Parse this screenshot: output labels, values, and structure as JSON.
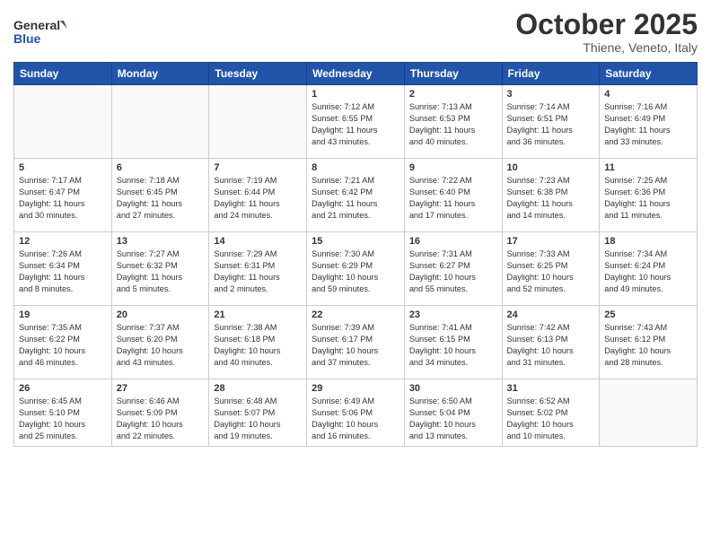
{
  "header": {
    "logo_general": "General",
    "logo_blue": "Blue",
    "month_title": "October 2025",
    "location": "Thiene, Veneto, Italy"
  },
  "days_of_week": [
    "Sunday",
    "Monday",
    "Tuesday",
    "Wednesday",
    "Thursday",
    "Friday",
    "Saturday"
  ],
  "weeks": [
    [
      {
        "day": "",
        "info": ""
      },
      {
        "day": "",
        "info": ""
      },
      {
        "day": "",
        "info": ""
      },
      {
        "day": "1",
        "info": "Sunrise: 7:12 AM\nSunset: 6:55 PM\nDaylight: 11 hours\nand 43 minutes."
      },
      {
        "day": "2",
        "info": "Sunrise: 7:13 AM\nSunset: 6:53 PM\nDaylight: 11 hours\nand 40 minutes."
      },
      {
        "day": "3",
        "info": "Sunrise: 7:14 AM\nSunset: 6:51 PM\nDaylight: 11 hours\nand 36 minutes."
      },
      {
        "day": "4",
        "info": "Sunrise: 7:16 AM\nSunset: 6:49 PM\nDaylight: 11 hours\nand 33 minutes."
      }
    ],
    [
      {
        "day": "5",
        "info": "Sunrise: 7:17 AM\nSunset: 6:47 PM\nDaylight: 11 hours\nand 30 minutes."
      },
      {
        "day": "6",
        "info": "Sunrise: 7:18 AM\nSunset: 6:45 PM\nDaylight: 11 hours\nand 27 minutes."
      },
      {
        "day": "7",
        "info": "Sunrise: 7:19 AM\nSunset: 6:44 PM\nDaylight: 11 hours\nand 24 minutes."
      },
      {
        "day": "8",
        "info": "Sunrise: 7:21 AM\nSunset: 6:42 PM\nDaylight: 11 hours\nand 21 minutes."
      },
      {
        "day": "9",
        "info": "Sunrise: 7:22 AM\nSunset: 6:40 PM\nDaylight: 11 hours\nand 17 minutes."
      },
      {
        "day": "10",
        "info": "Sunrise: 7:23 AM\nSunset: 6:38 PM\nDaylight: 11 hours\nand 14 minutes."
      },
      {
        "day": "11",
        "info": "Sunrise: 7:25 AM\nSunset: 6:36 PM\nDaylight: 11 hours\nand 11 minutes."
      }
    ],
    [
      {
        "day": "12",
        "info": "Sunrise: 7:26 AM\nSunset: 6:34 PM\nDaylight: 11 hours\nand 8 minutes."
      },
      {
        "day": "13",
        "info": "Sunrise: 7:27 AM\nSunset: 6:32 PM\nDaylight: 11 hours\nand 5 minutes."
      },
      {
        "day": "14",
        "info": "Sunrise: 7:29 AM\nSunset: 6:31 PM\nDaylight: 11 hours\nand 2 minutes."
      },
      {
        "day": "15",
        "info": "Sunrise: 7:30 AM\nSunset: 6:29 PM\nDaylight: 10 hours\nand 59 minutes."
      },
      {
        "day": "16",
        "info": "Sunrise: 7:31 AM\nSunset: 6:27 PM\nDaylight: 10 hours\nand 55 minutes."
      },
      {
        "day": "17",
        "info": "Sunrise: 7:33 AM\nSunset: 6:25 PM\nDaylight: 10 hours\nand 52 minutes."
      },
      {
        "day": "18",
        "info": "Sunrise: 7:34 AM\nSunset: 6:24 PM\nDaylight: 10 hours\nand 49 minutes."
      }
    ],
    [
      {
        "day": "19",
        "info": "Sunrise: 7:35 AM\nSunset: 6:22 PM\nDaylight: 10 hours\nand 46 minutes."
      },
      {
        "day": "20",
        "info": "Sunrise: 7:37 AM\nSunset: 6:20 PM\nDaylight: 10 hours\nand 43 minutes."
      },
      {
        "day": "21",
        "info": "Sunrise: 7:38 AM\nSunset: 6:18 PM\nDaylight: 10 hours\nand 40 minutes."
      },
      {
        "day": "22",
        "info": "Sunrise: 7:39 AM\nSunset: 6:17 PM\nDaylight: 10 hours\nand 37 minutes."
      },
      {
        "day": "23",
        "info": "Sunrise: 7:41 AM\nSunset: 6:15 PM\nDaylight: 10 hours\nand 34 minutes."
      },
      {
        "day": "24",
        "info": "Sunrise: 7:42 AM\nSunset: 6:13 PM\nDaylight: 10 hours\nand 31 minutes."
      },
      {
        "day": "25",
        "info": "Sunrise: 7:43 AM\nSunset: 6:12 PM\nDaylight: 10 hours\nand 28 minutes."
      }
    ],
    [
      {
        "day": "26",
        "info": "Sunrise: 6:45 AM\nSunset: 5:10 PM\nDaylight: 10 hours\nand 25 minutes."
      },
      {
        "day": "27",
        "info": "Sunrise: 6:46 AM\nSunset: 5:09 PM\nDaylight: 10 hours\nand 22 minutes."
      },
      {
        "day": "28",
        "info": "Sunrise: 6:48 AM\nSunset: 5:07 PM\nDaylight: 10 hours\nand 19 minutes."
      },
      {
        "day": "29",
        "info": "Sunrise: 6:49 AM\nSunset: 5:06 PM\nDaylight: 10 hours\nand 16 minutes."
      },
      {
        "day": "30",
        "info": "Sunrise: 6:50 AM\nSunset: 5:04 PM\nDaylight: 10 hours\nand 13 minutes."
      },
      {
        "day": "31",
        "info": "Sunrise: 6:52 AM\nSunset: 5:02 PM\nDaylight: 10 hours\nand 10 minutes."
      },
      {
        "day": "",
        "info": ""
      }
    ]
  ]
}
